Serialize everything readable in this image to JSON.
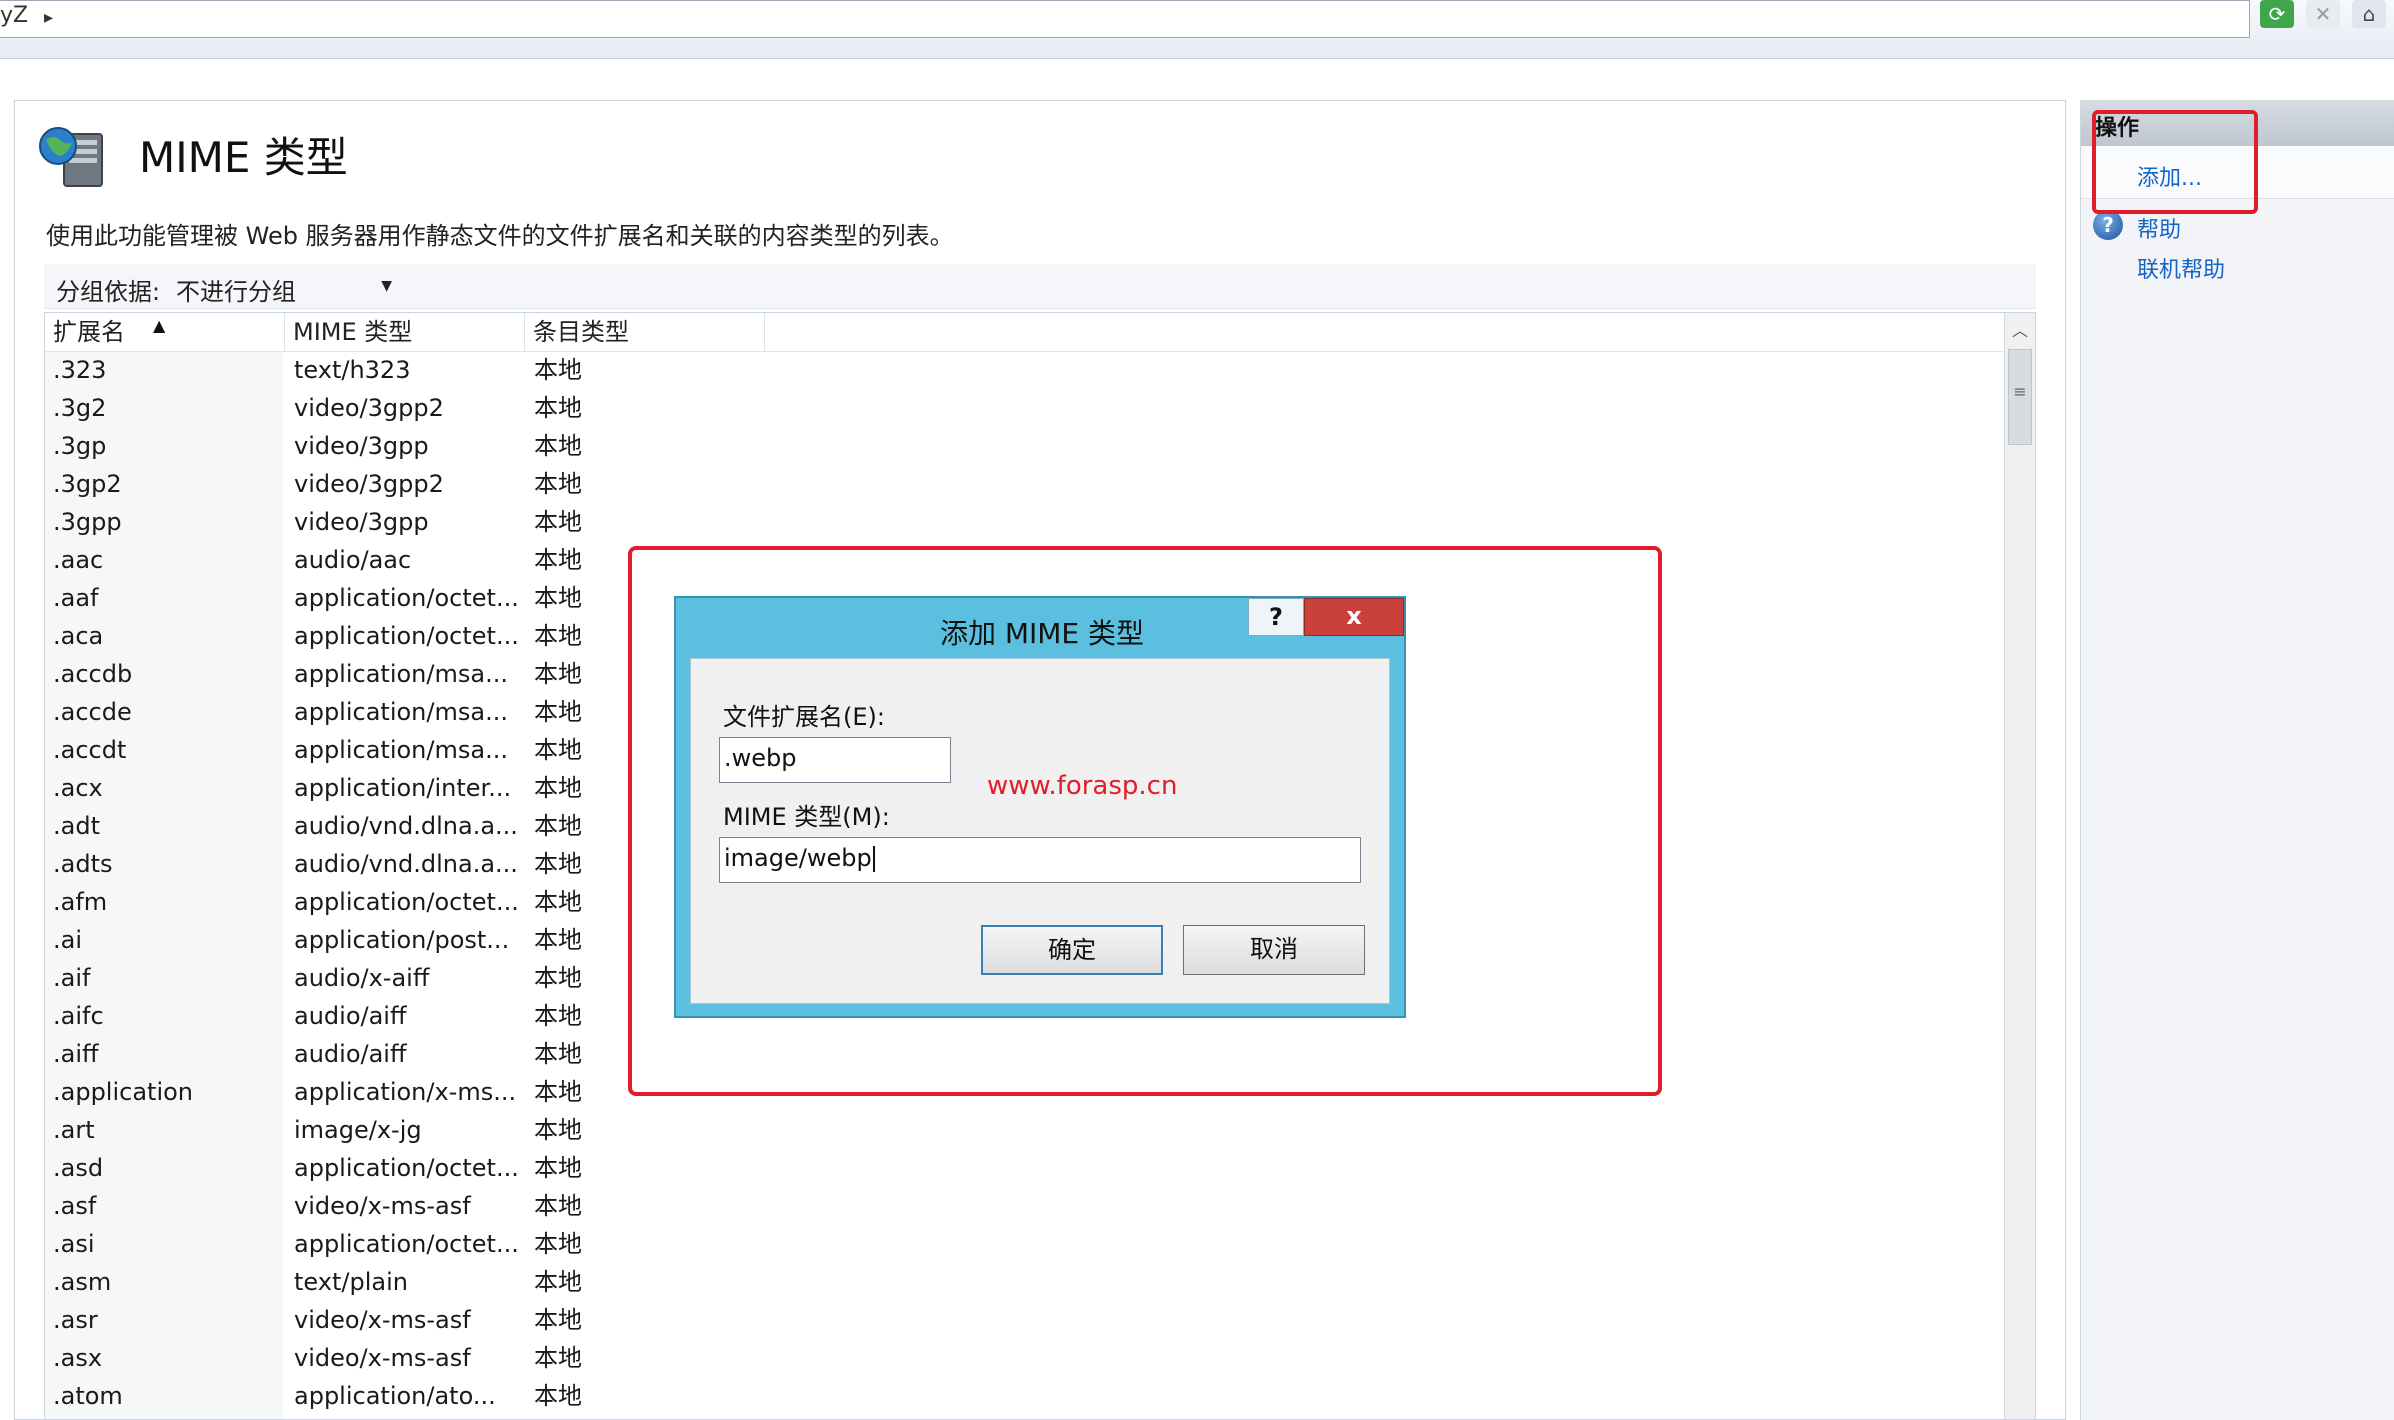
{
  "topbar": {
    "address_text": "yZ",
    "arrow": "▸",
    "icons": [
      "refresh-icon",
      "stop-icon",
      "home-icon"
    ]
  },
  "page": {
    "title": "MIME 类型",
    "description": "使用此功能管理被 Web 服务器用作静态文件的文件扩展名和关联的内容类型的列表。",
    "group_by_label": "分组依据:",
    "group_by_value": "不进行分组"
  },
  "table": {
    "columns": [
      "扩展名",
      "MIME 类型",
      "条目类型"
    ],
    "rows": [
      {
        "ext": ".323",
        "mime": "text/h323",
        "type": "本地"
      },
      {
        "ext": ".3g2",
        "mime": "video/3gpp2",
        "type": "本地"
      },
      {
        "ext": ".3gp",
        "mime": "video/3gpp",
        "type": "本地"
      },
      {
        "ext": ".3gp2",
        "mime": "video/3gpp2",
        "type": "本地"
      },
      {
        "ext": ".3gpp",
        "mime": "video/3gpp",
        "type": "本地"
      },
      {
        "ext": ".aac",
        "mime": "audio/aac",
        "type": "本地"
      },
      {
        "ext": ".aaf",
        "mime": "application/octet...",
        "type": "本地"
      },
      {
        "ext": ".aca",
        "mime": "application/octet...",
        "type": "本地"
      },
      {
        "ext": ".accdb",
        "mime": "application/msa...",
        "type": "本地"
      },
      {
        "ext": ".accde",
        "mime": "application/msa...",
        "type": "本地"
      },
      {
        "ext": ".accdt",
        "mime": "application/msa...",
        "type": "本地"
      },
      {
        "ext": ".acx",
        "mime": "application/inter...",
        "type": "本地"
      },
      {
        "ext": ".adt",
        "mime": "audio/vnd.dlna.a...",
        "type": "本地"
      },
      {
        "ext": ".adts",
        "mime": "audio/vnd.dlna.a...",
        "type": "本地"
      },
      {
        "ext": ".afm",
        "mime": "application/octet...",
        "type": "本地"
      },
      {
        "ext": ".ai",
        "mime": "application/post...",
        "type": "本地"
      },
      {
        "ext": ".aif",
        "mime": "audio/x-aiff",
        "type": "本地"
      },
      {
        "ext": ".aifc",
        "mime": "audio/aiff",
        "type": "本地"
      },
      {
        "ext": ".aiff",
        "mime": "audio/aiff",
        "type": "本地"
      },
      {
        "ext": ".application",
        "mime": "application/x-ms...",
        "type": "本地"
      },
      {
        "ext": ".art",
        "mime": "image/x-jg",
        "type": "本地"
      },
      {
        "ext": ".asd",
        "mime": "application/octet...",
        "type": "本地"
      },
      {
        "ext": ".asf",
        "mime": "video/x-ms-asf",
        "type": "本地"
      },
      {
        "ext": ".asi",
        "mime": "application/octet...",
        "type": "本地"
      },
      {
        "ext": ".asm",
        "mime": "text/plain",
        "type": "本地"
      },
      {
        "ext": ".asr",
        "mime": "video/x-ms-asf",
        "type": "本地"
      },
      {
        "ext": ".asx",
        "mime": "video/x-ms-asf",
        "type": "本地"
      },
      {
        "ext": ".atom",
        "mime": "application/ato...",
        "type": "本地"
      }
    ]
  },
  "actions": {
    "header": "操作",
    "add": "添加...",
    "help": "帮助",
    "online_help": "联机帮助"
  },
  "dialog": {
    "title": "添加 MIME 类型",
    "help_button": "?",
    "close_button": "x",
    "ext_label": "文件扩展名(E):",
    "ext_value": ".webp",
    "mime_label": "MIME 类型(M):",
    "mime_value": "image/webp",
    "ok": "确定",
    "cancel": "取消",
    "watermark": "www.forasp.cn"
  },
  "colors": {
    "annotation_red": "#e01e2b",
    "dialog_frame": "#5bc0df",
    "link_blue": "#1464c8",
    "close_red": "#c9413a"
  }
}
